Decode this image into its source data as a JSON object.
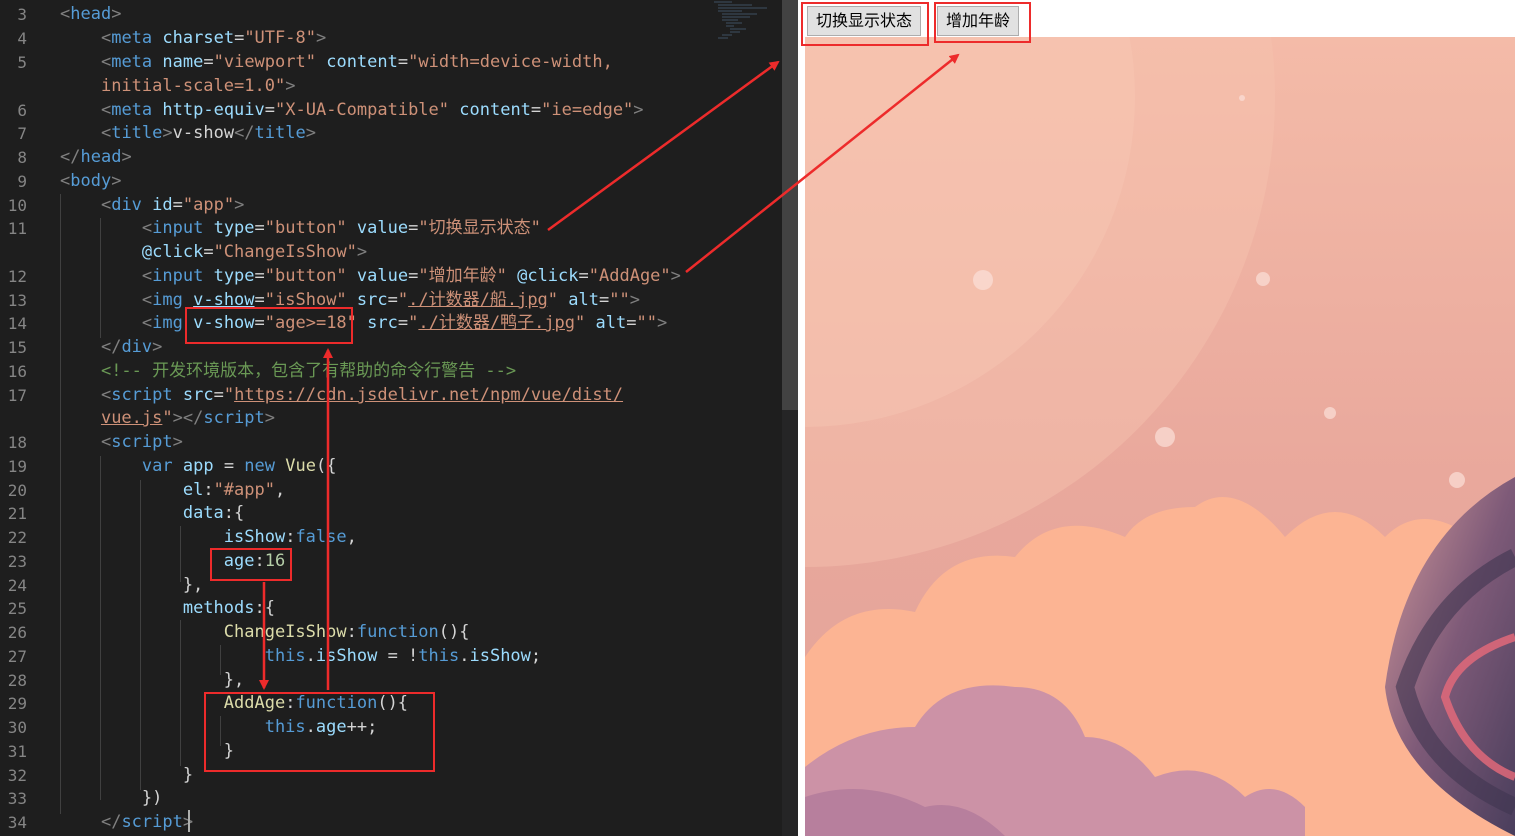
{
  "editor": {
    "line_numbers": [
      "3",
      "4",
      "5",
      "6",
      "7",
      "8",
      "9",
      "10",
      "11",
      "12",
      "13",
      "14",
      "15",
      "16",
      "17",
      "18",
      "19",
      "20",
      "21",
      "22",
      "23",
      "24",
      "25",
      "26",
      "27",
      "28",
      "29",
      "30",
      "31",
      "32",
      "33",
      "34"
    ]
  },
  "preview": {
    "toggle_button": "切换显示状态",
    "age_button": "增加年龄"
  },
  "colors": {
    "highlight": "#ed2b2b",
    "editor_bg": "#1e1e1e",
    "sky_top": "#f3b8a6",
    "cloud": "#fcb493",
    "cloud_purple": "#c78ea8"
  }
}
